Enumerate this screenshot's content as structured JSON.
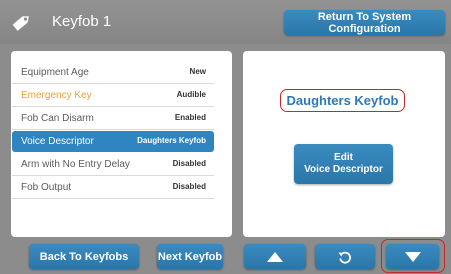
{
  "header": {
    "title": "Keyfob 1",
    "return_label": "Return To System Configuration"
  },
  "settings": [
    {
      "label": "Equipment Age",
      "value": "New",
      "style": "normal"
    },
    {
      "label": "Emergency Key",
      "value": "Audible",
      "style": "orange"
    },
    {
      "label": "Fob Can Disarm",
      "value": "Enabled",
      "style": "normal"
    },
    {
      "label": "Voice Descriptor",
      "value": "Daughters Keyfob",
      "style": "selected"
    },
    {
      "label": "Arm with No Entry Delay",
      "value": "Disabled",
      "style": "normal"
    },
    {
      "label": "Fob Output",
      "value": "Disabled",
      "style": "normal"
    }
  ],
  "detail": {
    "voice_name": "Daughters Keyfob",
    "edit_line1": "Edit",
    "edit_line2": "Voice Descriptor"
  },
  "footer": {
    "back_label": "Back To Keyfobs",
    "next_label": "Next Keyfob"
  },
  "colors": {
    "accent": "#2e85c0",
    "highlight": "#c02a2a",
    "orange": "#e9a33a"
  },
  "icons": {
    "header": "tag-icon",
    "up": "triangle-up-icon",
    "undo": "undo-arrow-icon",
    "down": "triangle-down-icon"
  }
}
